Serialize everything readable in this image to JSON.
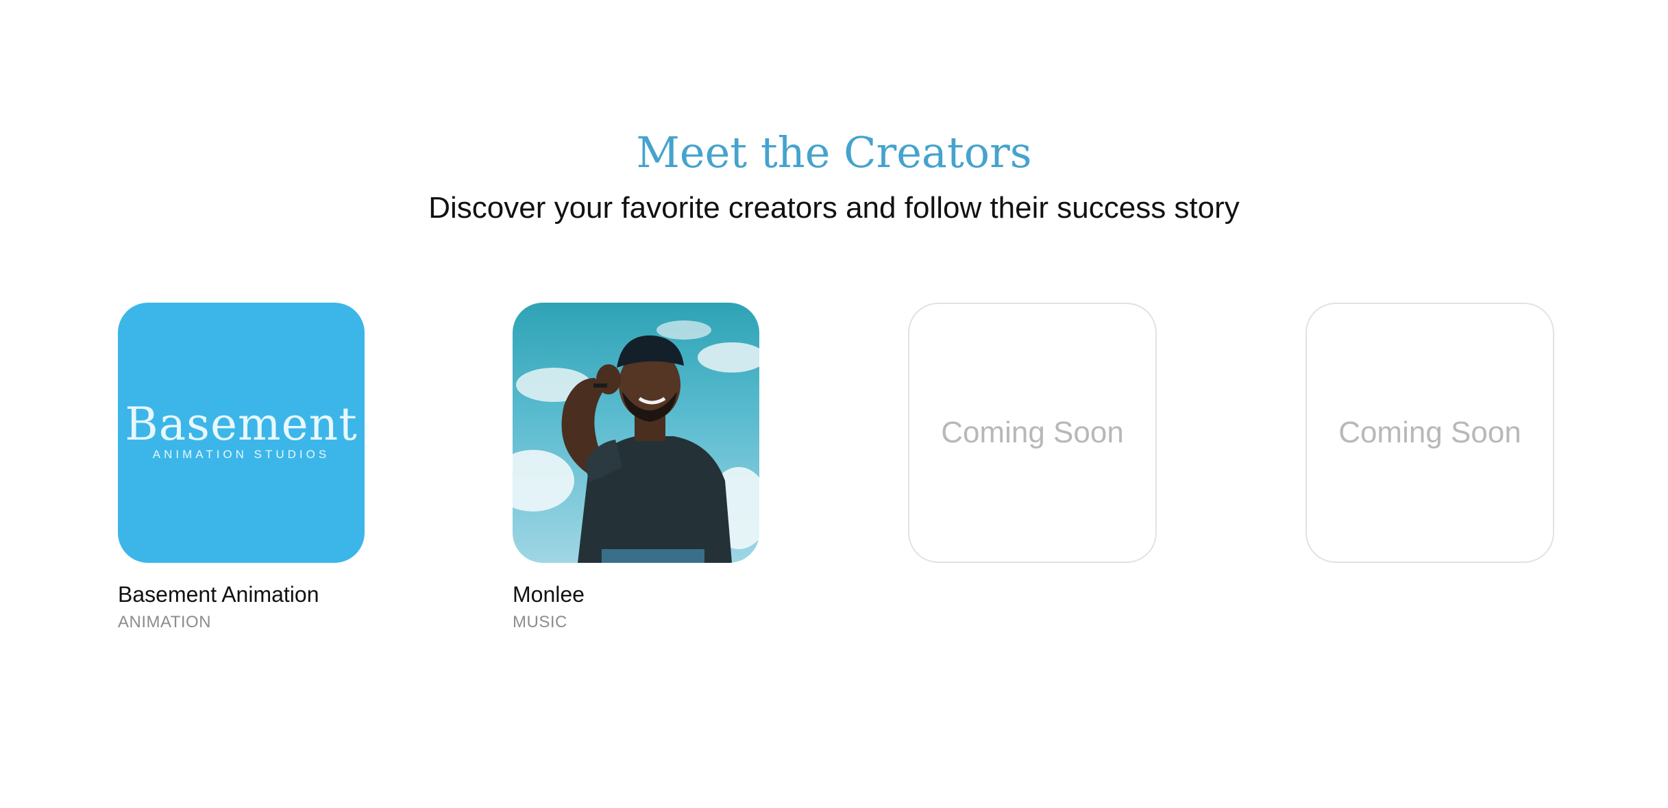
{
  "header": {
    "title": "Meet the Creators",
    "subtitle": "Discover your favorite creators and follow their success story"
  },
  "creators": [
    {
      "name": "Basement Animation",
      "category": "ANIMATION",
      "logo_wordmark": "Basement",
      "logo_sub": "ANIMATION STUDIOS",
      "tile_color": "#3cb6e9"
    },
    {
      "name": "Monlee",
      "category": "MUSIC"
    }
  ],
  "placeholders": [
    {
      "label": "Coming Soon"
    },
    {
      "label": "Coming Soon"
    }
  ],
  "colors": {
    "title": "#45a3cd",
    "text": "#111111",
    "muted": "#8c8c8c",
    "placeholder_text": "#b8b8b8",
    "placeholder_border": "#e2e2e2"
  }
}
